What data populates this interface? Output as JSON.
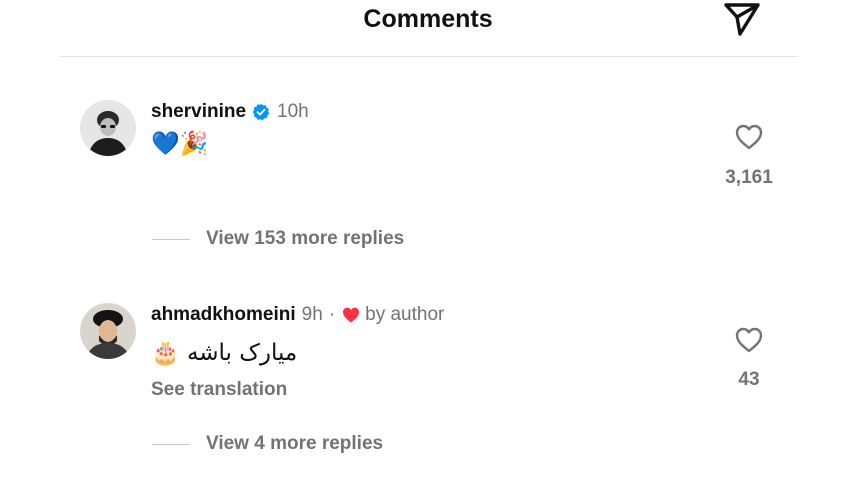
{
  "header": {
    "title": "Comments",
    "send_icon": "paper-plane-icon"
  },
  "comments": [
    {
      "username": "shervinine",
      "verified": true,
      "time": "10h",
      "text": "💙🎉",
      "like_count": "3,161",
      "replies_label": "View 153 more replies",
      "avatar": "man-with-glasses-avatar"
    },
    {
      "username": "ahmadkhomeini",
      "time": "9h",
      "separator": "·",
      "liked_by_author": "by author",
      "text": "میارک باشه 🎂",
      "translation_label": "See translation",
      "like_count": "43",
      "replies_label": "View 4 more replies",
      "avatar": "cleric-avatar"
    }
  ],
  "colors": {
    "text": "#111111",
    "muted": "#737373",
    "verified_blue": "#0095f6",
    "heart_red": "#ff3040",
    "divider": "#e4e4e4"
  }
}
